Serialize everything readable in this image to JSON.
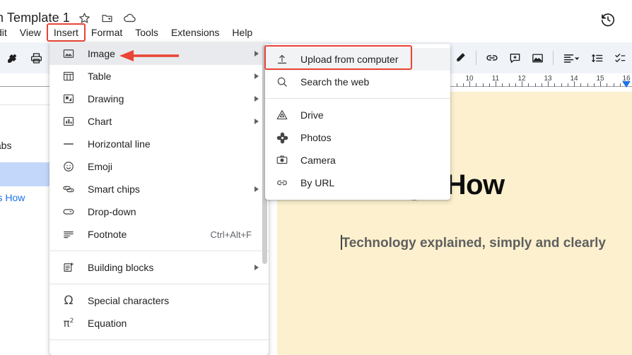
{
  "window": {
    "doc_title": "m Template 1",
    "title_icons": [
      "star-icon",
      "move-to-folder-icon",
      "cloud-saved-icon"
    ],
    "history_icon": "version-history-icon"
  },
  "menubar": {
    "items": [
      {
        "label": "dit",
        "name": "menu-edit",
        "highlighted": false
      },
      {
        "label": "View",
        "name": "menu-view",
        "highlighted": false
      },
      {
        "label": "Insert",
        "name": "menu-insert",
        "highlighted": true
      },
      {
        "label": "Format",
        "name": "menu-format",
        "highlighted": false
      },
      {
        "label": "Tools",
        "name": "menu-tools",
        "highlighted": false
      },
      {
        "label": "Extensions",
        "name": "menu-extensions",
        "highlighted": false
      },
      {
        "label": "Help",
        "name": "menu-help",
        "highlighted": false
      }
    ]
  },
  "toolbar": {
    "left_buttons": [
      {
        "name": "paint-format-icon"
      },
      {
        "name": "print-icon"
      },
      {
        "name": "spelling-check-icon"
      }
    ],
    "right_buttons": [
      {
        "name": "text-color-icon"
      },
      {
        "name": "highlight-color-icon"
      },
      {
        "name": "insert-link-icon"
      },
      {
        "name": "add-comment-icon"
      },
      {
        "name": "insert-image-icon"
      },
      {
        "name": "align-icon"
      },
      {
        "name": "line-spacing-icon"
      },
      {
        "name": "checklist-icon"
      }
    ]
  },
  "ruler": {
    "numbers": [
      "10",
      "11",
      "12",
      "13",
      "14",
      "15",
      "16"
    ],
    "marker": "right-indent-marker"
  },
  "sidebar": {
    "header_label": "tabs",
    "selected_item_label": "",
    "sub_item_label": "hings How"
  },
  "document": {
    "heading": "Things How",
    "subtitle": "Technology explained, simply and clearly",
    "page_background": "#fcf0ce"
  },
  "insert_menu": {
    "items": [
      {
        "label": "Image",
        "icon": "image-icon",
        "shortcut": "",
        "submenu": true,
        "highlighted": true,
        "divider_after": false
      },
      {
        "label": "Table",
        "icon": "table-icon",
        "shortcut": "",
        "submenu": true,
        "highlighted": false,
        "divider_after": false
      },
      {
        "label": "Drawing",
        "icon": "drawing-icon",
        "shortcut": "",
        "submenu": true,
        "highlighted": false,
        "divider_after": false
      },
      {
        "label": "Chart",
        "icon": "chart-icon",
        "shortcut": "",
        "submenu": true,
        "highlighted": false,
        "divider_after": false
      },
      {
        "label": "Horizontal line",
        "icon": "horizontal-line-icon",
        "shortcut": "",
        "submenu": false,
        "highlighted": false,
        "divider_after": false
      },
      {
        "label": "Emoji",
        "icon": "emoji-icon",
        "shortcut": "",
        "submenu": false,
        "highlighted": false,
        "divider_after": false
      },
      {
        "label": "Smart chips",
        "icon": "smart-chips-icon",
        "shortcut": "",
        "submenu": true,
        "highlighted": false,
        "divider_after": false
      },
      {
        "label": "Drop-down",
        "icon": "drop-down-icon",
        "shortcut": "",
        "submenu": false,
        "highlighted": false,
        "divider_after": false
      },
      {
        "label": "Footnote",
        "icon": "footnote-icon",
        "shortcut": "Ctrl+Alt+F",
        "submenu": false,
        "highlighted": false,
        "divider_after": true
      },
      {
        "label": "Building blocks",
        "icon": "building-blocks-icon",
        "shortcut": "",
        "submenu": true,
        "highlighted": false,
        "divider_after": true
      },
      {
        "label": "Special characters",
        "icon": "special-characters-icon",
        "shortcut": "",
        "submenu": false,
        "highlighted": false,
        "divider_after": false
      },
      {
        "label": "Equation",
        "icon": "equation-icon",
        "shortcut": "",
        "submenu": false,
        "highlighted": false,
        "divider_after": true
      }
    ]
  },
  "image_submenu": {
    "items": [
      {
        "label": "Upload from computer",
        "icon": "upload-icon",
        "highlighted": true,
        "divider_after": false
      },
      {
        "label": "Search the web",
        "icon": "search-icon",
        "highlighted": false,
        "divider_after": true
      },
      {
        "label": "Drive",
        "icon": "drive-icon",
        "highlighted": false,
        "divider_after": false
      },
      {
        "label": "Photos",
        "icon": "photos-icon",
        "highlighted": false,
        "divider_after": false
      },
      {
        "label": "Camera",
        "icon": "camera-icon",
        "highlighted": false,
        "divider_after": false
      },
      {
        "label": "By URL",
        "icon": "link-icon",
        "highlighted": false,
        "divider_after": false
      }
    ]
  },
  "annotations": {
    "accent_color": "#ea4335",
    "arrow_name": "red-pointer-arrow",
    "boxes": [
      "insert-menu-highlight-box",
      "image-item-arrow",
      "upload-from-computer-highlight-box"
    ]
  }
}
